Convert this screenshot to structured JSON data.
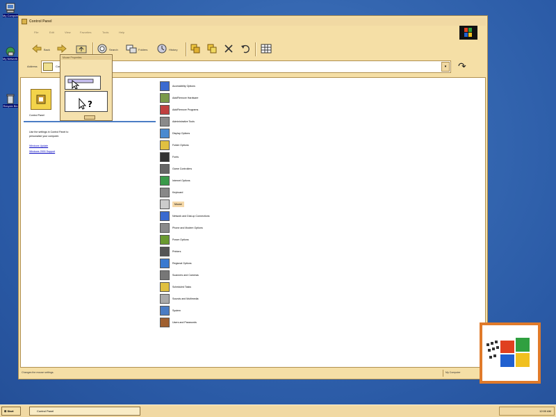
{
  "desktop": {
    "icons": [
      {
        "name": "my-computer",
        "label": "My Computer"
      },
      {
        "name": "network-neighborhood",
        "label": "My Network Places"
      },
      {
        "name": "recycle-bin",
        "label": "Recycle Bin"
      }
    ]
  },
  "window": {
    "title": "Control Panel",
    "menu": [
      "File",
      "Edit",
      "View",
      "Favorites",
      "Tools",
      "Help"
    ],
    "toolbar": {
      "back_label": "Back",
      "forward_label": "",
      "up_label": "",
      "search_label": "Search",
      "folders_label": "Folders",
      "history_label": "History"
    },
    "address": {
      "label": "Address",
      "value": "Control Panel"
    },
    "left_pane": {
      "title": "Control Panel",
      "description_line1": "Use the settings in Control Panel to",
      "description_line2": "personalize your computer.",
      "link1": "Windows Update",
      "link2": "Windows 2000 Support"
    },
    "items": [
      {
        "label": "Accessibility Options",
        "icon": "accessibility-icon"
      },
      {
        "label": "Add/Remove Hardware",
        "icon": "add-hardware-icon"
      },
      {
        "label": "Add/Remove Programs",
        "icon": "add-programs-icon"
      },
      {
        "label": "Administrative Tools",
        "icon": "admin-tools-icon"
      },
      {
        "label": "Display Options",
        "icon": "display-icon"
      },
      {
        "label": "Folder Options",
        "icon": "folder-options-icon"
      },
      {
        "label": "Fonts",
        "icon": "fonts-icon"
      },
      {
        "label": "Game Controllers",
        "icon": "game-controllers-icon"
      },
      {
        "label": "Internet Options",
        "icon": "internet-options-icon"
      },
      {
        "label": "Keyboard",
        "icon": "keyboard-icon"
      },
      {
        "label": "Mouse",
        "icon": "mouse-icon",
        "selected": true
      },
      {
        "label": "Network and Dial-up Connections",
        "icon": "network-icon"
      },
      {
        "label": "Phone and Modem Options",
        "icon": "phone-modem-icon"
      },
      {
        "label": "Power Options",
        "icon": "power-options-icon"
      },
      {
        "label": "Printers",
        "icon": "printers-icon"
      },
      {
        "label": "Regional Options",
        "icon": "regional-icon"
      },
      {
        "label": "Scanners and Cameras",
        "icon": "scanners-icon"
      },
      {
        "label": "Scheduled Tasks",
        "icon": "scheduled-tasks-icon"
      },
      {
        "label": "Sounds and Multimedia",
        "icon": "sounds-icon"
      },
      {
        "label": "System",
        "icon": "system-icon"
      },
      {
        "label": "Users and Passwords",
        "icon": "users-icon"
      }
    ],
    "status": {
      "left": "Changes the mouse settings.",
      "right": "My Computer"
    }
  },
  "popup": {
    "title": "Mouse Properties"
  },
  "taskbar": {
    "start_label": "Start",
    "task_label": "Control Panel",
    "clock": "12:00 AM"
  },
  "colors": {
    "desktop": "#3466b0",
    "window_face": "#f5dfa6",
    "selection": "#f5d8a8",
    "link": "#0000c0"
  }
}
